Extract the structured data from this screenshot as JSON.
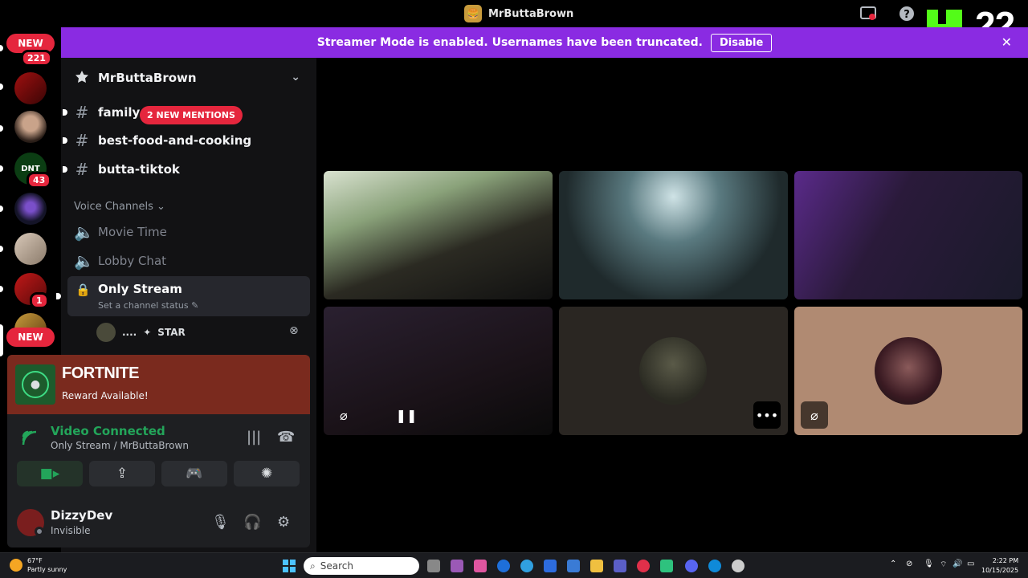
{
  "window": {
    "title": "MrButtaBrown"
  },
  "overlay": {
    "kick_count": "22"
  },
  "banner": {
    "text": "Streamer Mode is enabled. Usernames have been truncated.",
    "disable_label": "Disable"
  },
  "rail": {
    "new_top": "NEW",
    "count_top": "221",
    "count_server4": "43",
    "count_server7": "1",
    "new_bottom": "NEW"
  },
  "server": {
    "name": "MrButtaBrown",
    "channels": [
      {
        "name": "family-r",
        "mentions": "2 NEW MENTIONS"
      },
      {
        "name": "best-food-and-cooking"
      },
      {
        "name": "butta-tiktok"
      }
    ],
    "voice_category": "Voice Channels",
    "voice_channels": [
      {
        "name": "Movie Time"
      },
      {
        "name": "Lobby Chat"
      },
      {
        "name": "Only Stream",
        "status": "Set a channel status"
      }
    ],
    "voice_user": {
      "prefix": "....",
      "name": "STAR"
    }
  },
  "promo": {
    "game": "FORTNITE",
    "text": "Reward Available!"
  },
  "voice": {
    "status": "Video Connected",
    "location": "Only Stream / MrButtaBrown"
  },
  "user": {
    "name": "DizzyDev",
    "status": "Invisible"
  },
  "taskbar": {
    "temp": "67°F",
    "weather": "Partly sunny",
    "search_placeholder": "Search",
    "time": "2:22 PM",
    "date": "10/15/2025"
  },
  "colors": {
    "banner": "#8a2be2",
    "mention_red": "#e5263d",
    "connected_green": "#23a55a",
    "kick_green": "#53fc18"
  }
}
